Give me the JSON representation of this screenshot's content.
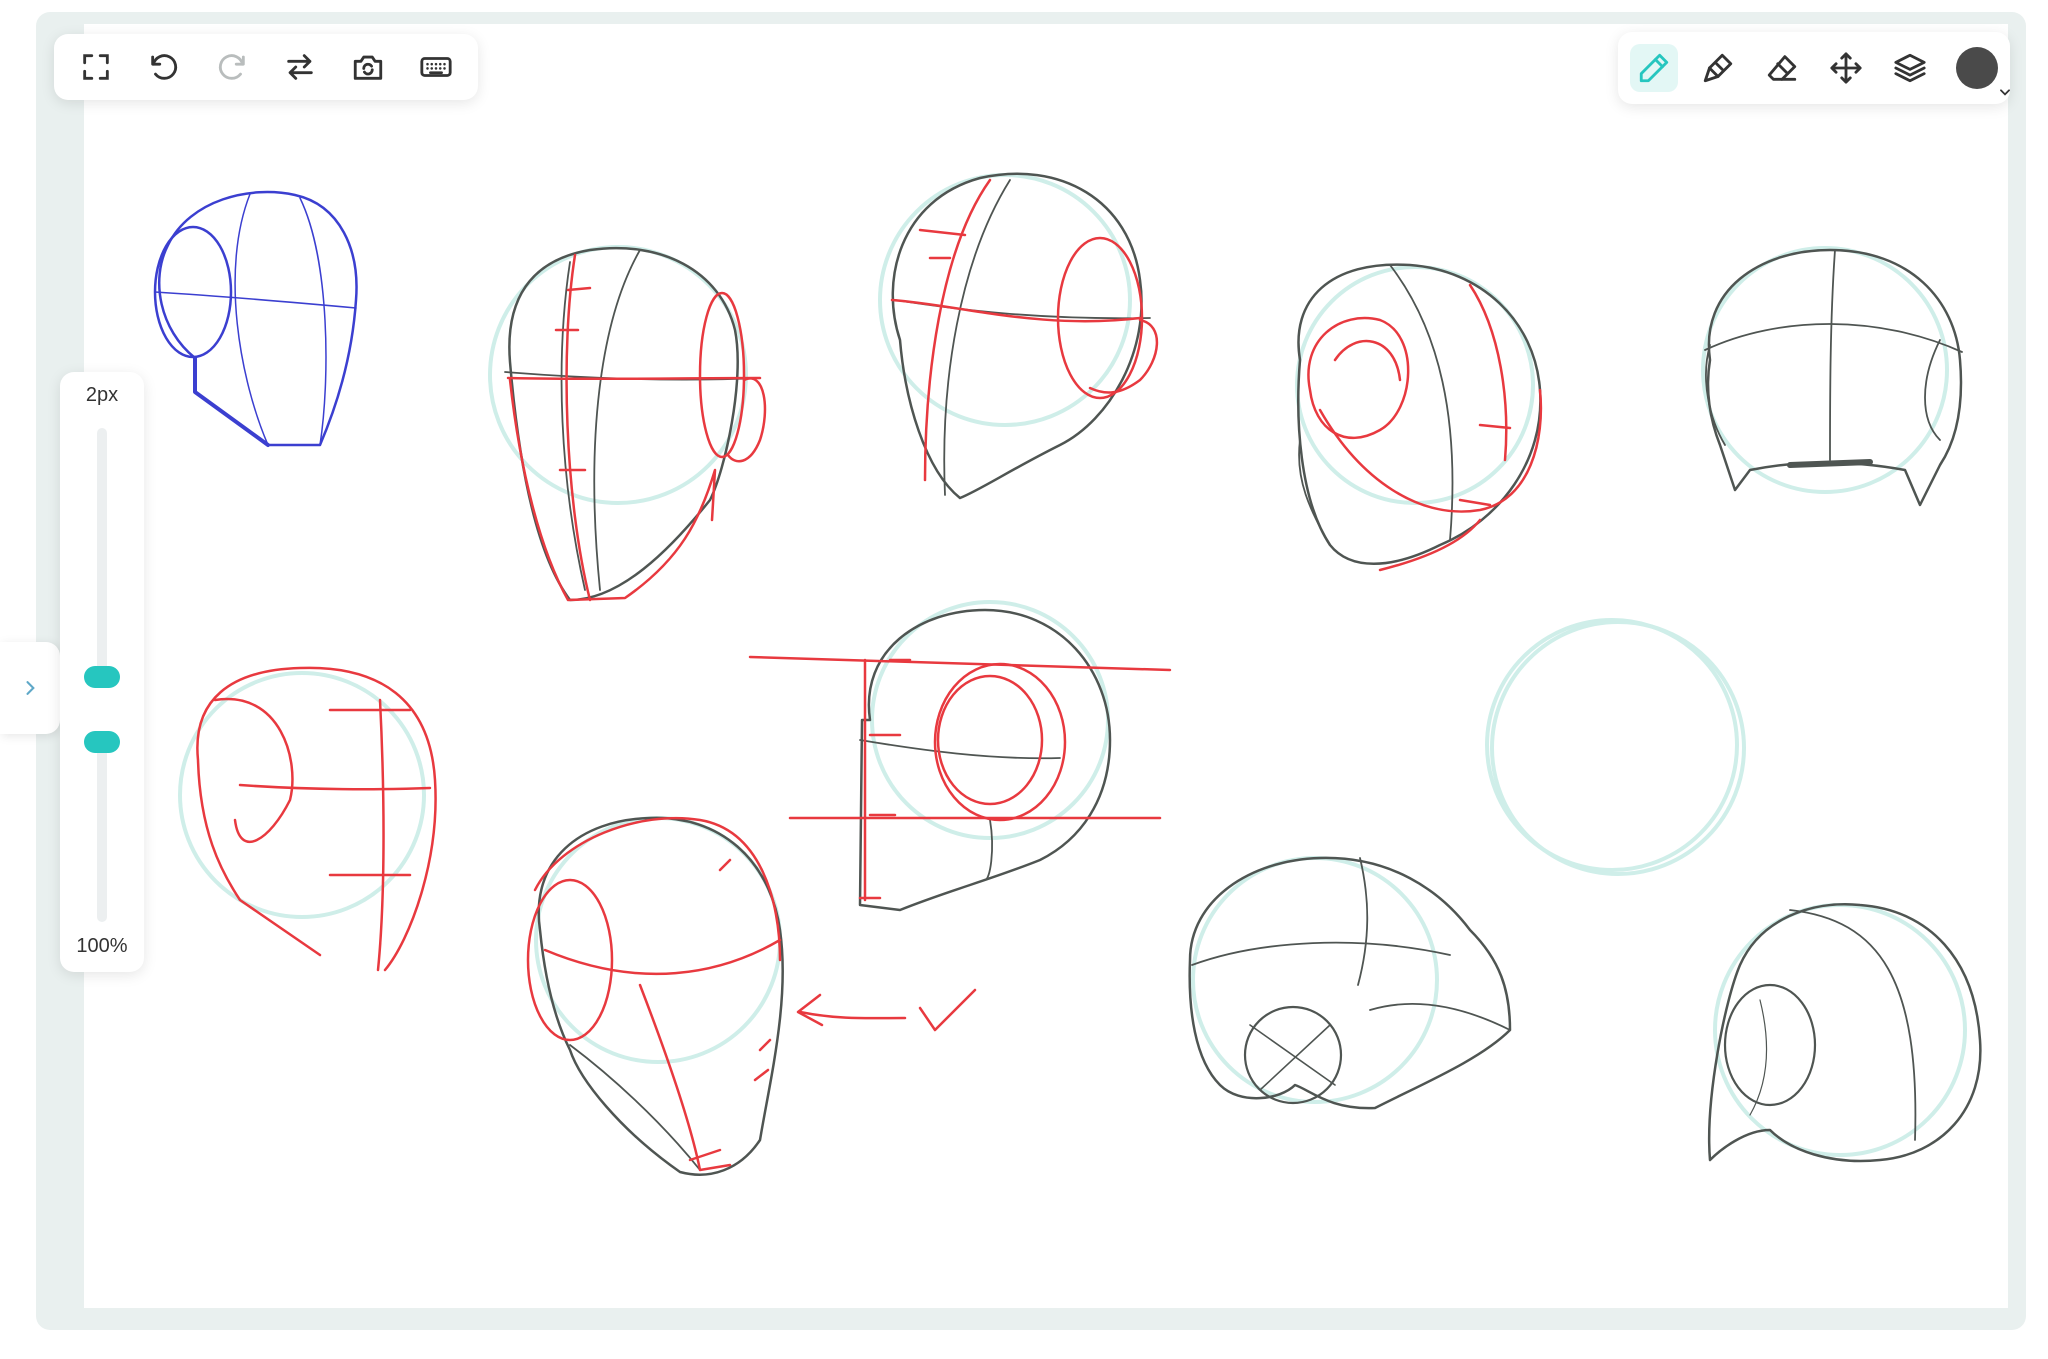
{
  "app": {
    "accent_color": "#26c6bf",
    "ink_color": "#4a4a4a",
    "sketch_colors": {
      "graphite": "#4f5552",
      "red": "#e8393f",
      "blue": "#3b3fd0",
      "guide": "#cfeee9"
    }
  },
  "toolbar_left": {
    "tools": [
      {
        "name": "fullscreen",
        "icon": "fullscreen-icon"
      },
      {
        "name": "undo",
        "icon": "undo-icon"
      },
      {
        "name": "redo",
        "icon": "redo-icon",
        "disabled": true
      },
      {
        "name": "swap",
        "icon": "swap-arrows-icon"
      },
      {
        "name": "camera-switch",
        "icon": "camera-rotate-icon"
      },
      {
        "name": "keyboard",
        "icon": "keyboard-icon"
      }
    ]
  },
  "toolbar_right": {
    "tools": [
      {
        "name": "pencil",
        "icon": "pencil-icon",
        "active": true
      },
      {
        "name": "marker",
        "icon": "marker-icon"
      },
      {
        "name": "eraser",
        "icon": "eraser-icon"
      },
      {
        "name": "move",
        "icon": "move-arrows-icon"
      },
      {
        "name": "layers",
        "icon": "layers-icon"
      }
    ],
    "current_color": "#4a4a4a"
  },
  "size_slider": {
    "size_label": "2px",
    "opacity_label": "100%",
    "size_value": 2,
    "opacity_percent": 100
  },
  "side_panel": {
    "toggle_icon": "chevron-right-icon"
  }
}
